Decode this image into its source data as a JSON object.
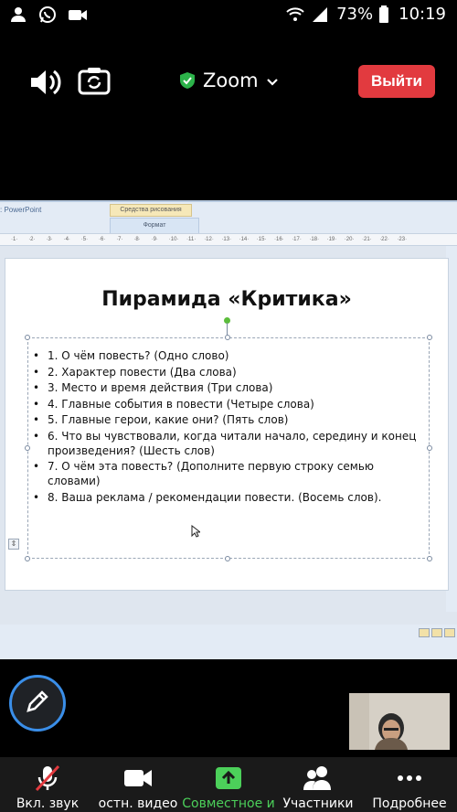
{
  "status_bar": {
    "battery": "73%",
    "time": "10:19",
    "left_icons": [
      "person-icon",
      "whatsapp-icon",
      "video-icon"
    ],
    "right_icons": [
      "wifi-icon",
      "signal-icon",
      "battery-icon"
    ]
  },
  "zoom_top": {
    "title": "Zoom",
    "leave_label": "Выйти",
    "accent": "#e23a3f",
    "shield_color": "#2cb34a"
  },
  "shared_screen": {
    "app_label": ": PowerPoint",
    "tool_tab": "Средства рисования",
    "format_tab": "Формат",
    "ruler_ticks": [
      "1",
      "2",
      "3",
      "4",
      "5",
      "6",
      "7",
      "8",
      "9",
      "10",
      "11",
      "12",
      "13",
      "14",
      "15",
      "16",
      "17",
      "18",
      "19",
      "20",
      "21",
      "22",
      "23"
    ],
    "slide": {
      "title": "Пирамида  «Критика»",
      "points": [
        "1. О чём повесть? (Одно слово)",
        "2. Характер повести (Два слова)",
        "3. Место и время действия (Три слова)",
        "4. Главные события в повести  (Четыре слова)",
        "5. Главные герои, какие они? (Пять слов)",
        "6. Что вы чувствовали, когда читали начало, середину и конец произведения? (Шесть слов)",
        "7. О чём эта повесть? (Дополните первую строку семью словами)",
        "8. Ваша реклама / рекомендации повести.  (Восемь слов)."
      ]
    }
  },
  "toolbar": {
    "items": [
      {
        "label": "Вкл. звук",
        "icon": "muted-mic-icon"
      },
      {
        "label": "остн. видео",
        "icon": "video-camera-icon"
      },
      {
        "label": "Совместное и",
        "icon": "share-screen-icon",
        "color": "#4cd05a"
      },
      {
        "label": "Участники",
        "icon": "participants-icon"
      },
      {
        "label": "Подробнее",
        "icon": "more-icon"
      }
    ]
  }
}
